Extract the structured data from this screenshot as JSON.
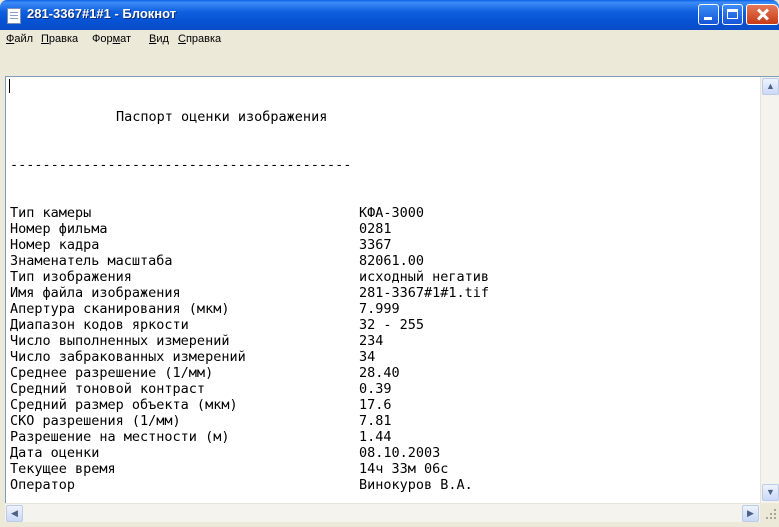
{
  "window": {
    "title": "281-3367#1#1 - Блокнот"
  },
  "menu": [
    {
      "pre": "",
      "acc": "Ф",
      "post": "айл"
    },
    {
      "pre": "",
      "acc": "П",
      "post": "равка"
    },
    {
      "pre": "Фор",
      "acc": "м",
      "post": "ат"
    },
    {
      "pre": "",
      "acc": "В",
      "post": "ид"
    },
    {
      "pre": "",
      "acc": "С",
      "post": "правка"
    }
  ],
  "document": {
    "heading": "Паспорт оценки изображения",
    "separator": "------------------------------------------",
    "rows": [
      {
        "label": "Тип камеры",
        "value": "КФА-3000"
      },
      {
        "label": "Номер фильма",
        "value": "0281"
      },
      {
        "label": "Номер кадра",
        "value": "3367"
      },
      {
        "label": "Знаменатель масштаба",
        "value": "82061.00"
      },
      {
        "label": "Тип изображения",
        "value": "исходный негатив"
      },
      {
        "label": "Имя файла изображения",
        "value": "281-3367#1#1.tif"
      },
      {
        "label": "Апертура сканирования (мкм)",
        "value": "7.999"
      },
      {
        "label": "Диапазон кодов яркости",
        "value": "32 - 255"
      },
      {
        "label": "Число выполненных измерений",
        "value": "234"
      },
      {
        "label": "Число забракованных измерений",
        "value": "34"
      },
      {
        "label": "Среднее разрешение (1/мм)",
        "value": "28.40"
      },
      {
        "label": "Средний тоновой контраст",
        "value": "0.39"
      },
      {
        "label": "Средний размер объекта (мкм)",
        "value": "17.6"
      },
      {
        "label": "СКО разрешения (1/мм)",
        "value": "7.81"
      },
      {
        "label": "Разрешение на местности (м)",
        "value": "1.44"
      },
      {
        "label": "Дата оценки",
        "value": "08.10.2003"
      },
      {
        "label": "Текущее время",
        "value": "14ч 33м 06с"
      },
      {
        "label": "Оператор",
        "value": "Винокуров В.А."
      }
    ]
  }
}
